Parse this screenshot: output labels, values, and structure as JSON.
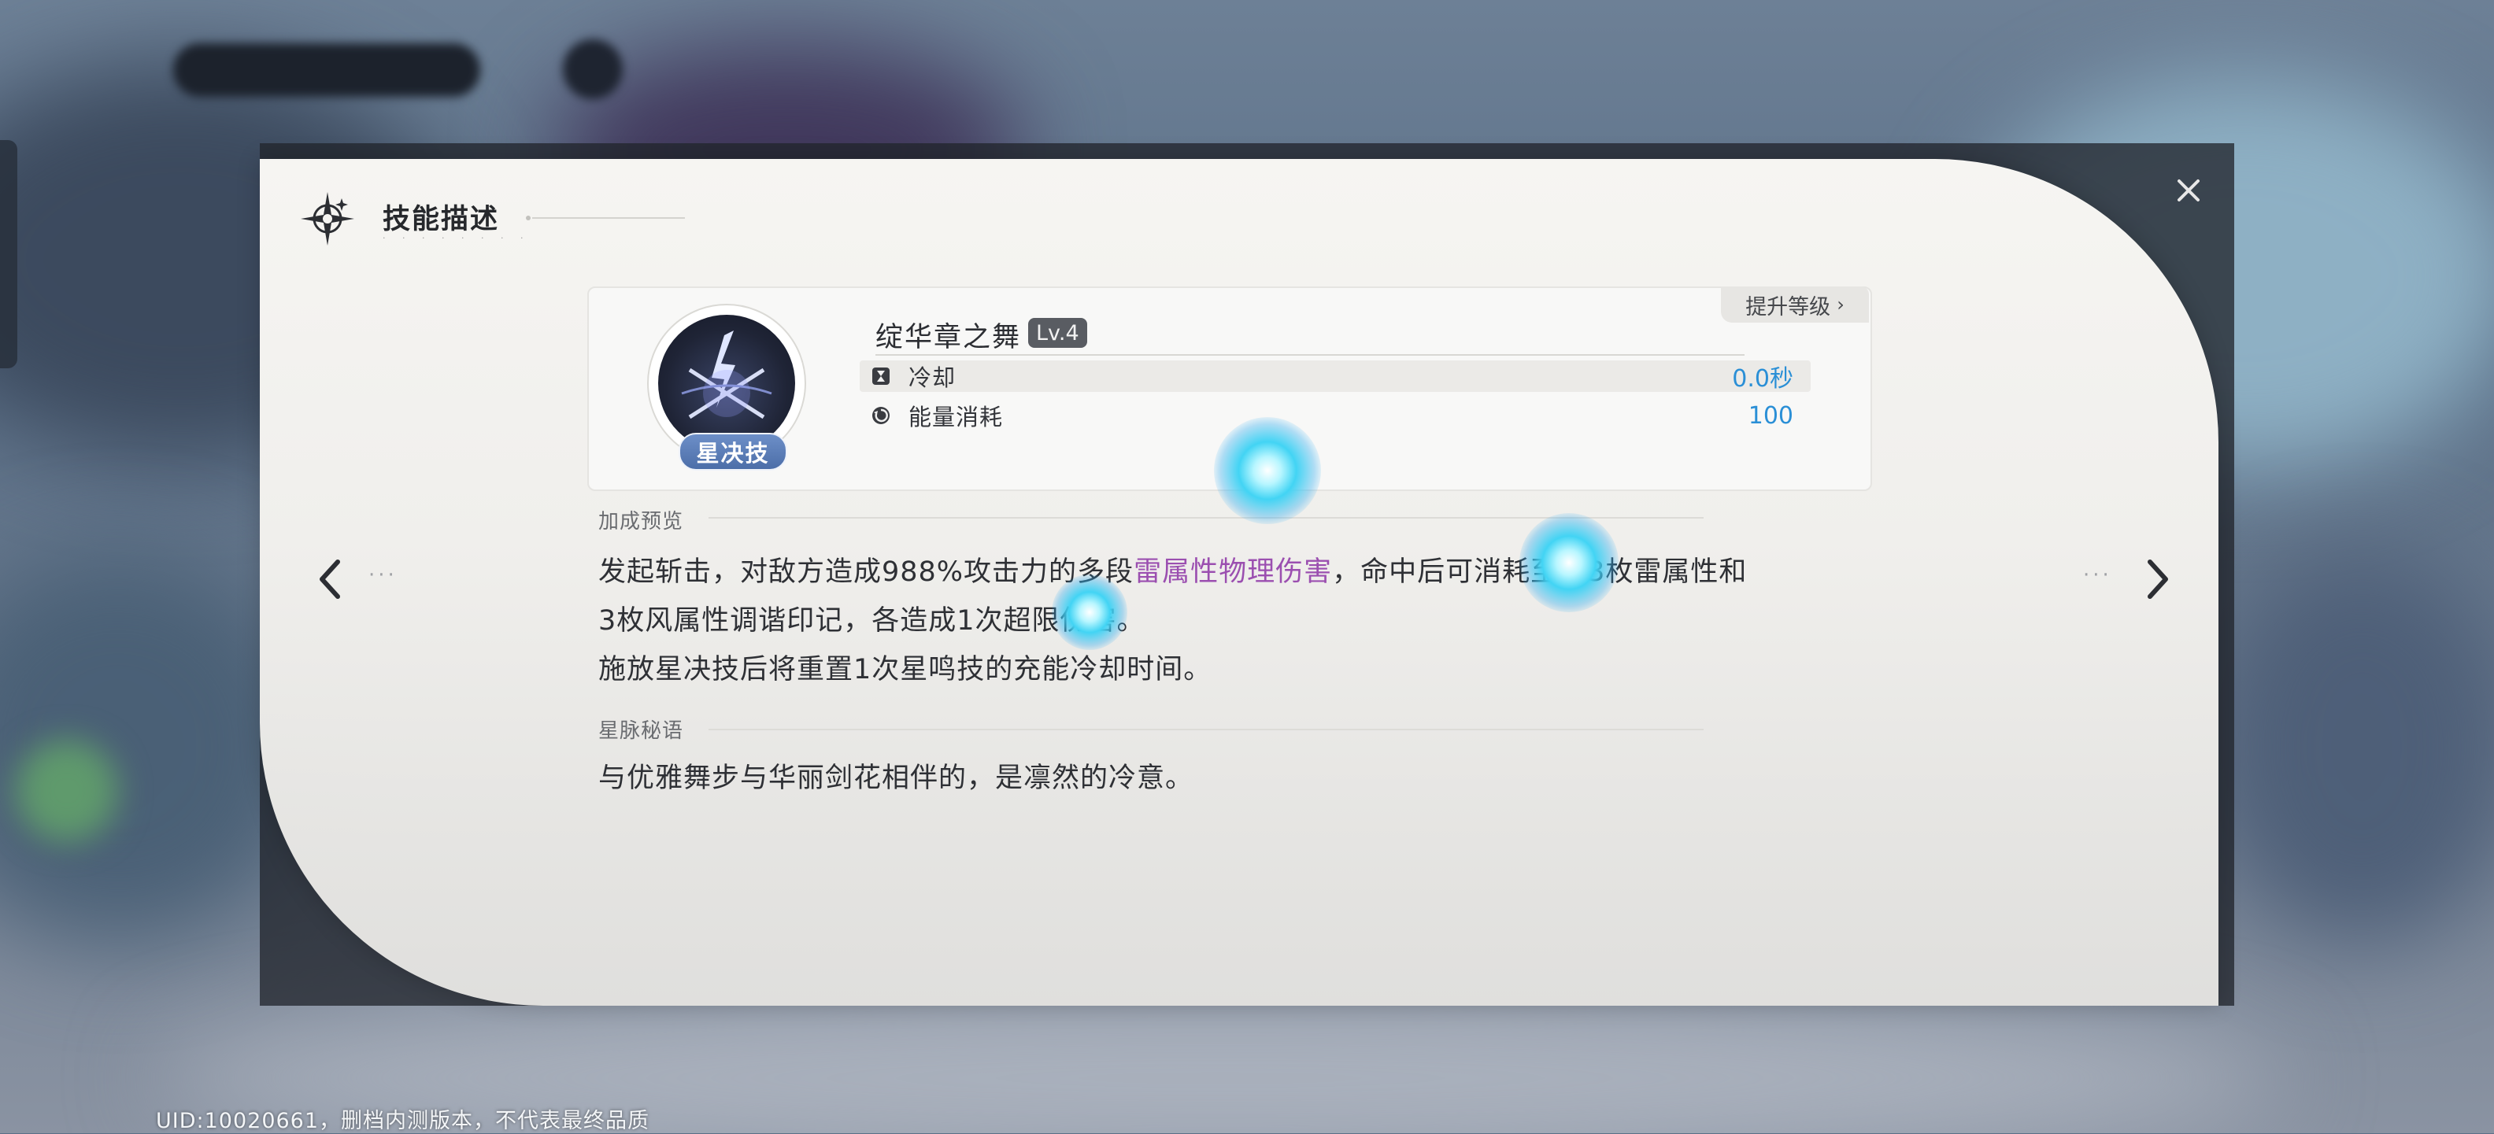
{
  "header": {
    "title": "技能描述",
    "icon": "four-point-star-compass-icon"
  },
  "skill": {
    "name": "绽华章之舞",
    "level": "Lv.4",
    "type_tag": "星决技",
    "icon": "lightning-crossed-swords-icon",
    "upgrade_label": "提升等级",
    "stats": [
      {
        "icon": "hourglass-icon",
        "label": "冷却",
        "value": "0.0秒"
      },
      {
        "icon": "energy-cycle-icon",
        "label": "能量消耗",
        "value": "100"
      }
    ]
  },
  "bonus_preview": {
    "title": "加成预览",
    "line1_a": "发起斩击，对敌方造成988%攻击力的多段",
    "line1_highlight": "雷属性物理伤害",
    "line1_b": "，命中后可消耗至多3枚雷属性和",
    "line2": "3枚风属性调谐印记，各造成1次超限伤害。",
    "line3": "施放星决技后将重置1次星鸣技的充能冷却时间。"
  },
  "star_vein": {
    "title": "星脉秘语",
    "text": "与优雅舞步与华丽剑花相伴的，是凛然的冷意。"
  },
  "nav": {
    "dots": "···"
  },
  "footer": {
    "uid": "UID:10020661，删档内测版本，不代表最终品质"
  },
  "colors": {
    "highlight": "#9b4fb0",
    "stat_value": "#2a8fd6",
    "tag_bg": "#5a7cb8",
    "orb": "#42d4f4"
  }
}
